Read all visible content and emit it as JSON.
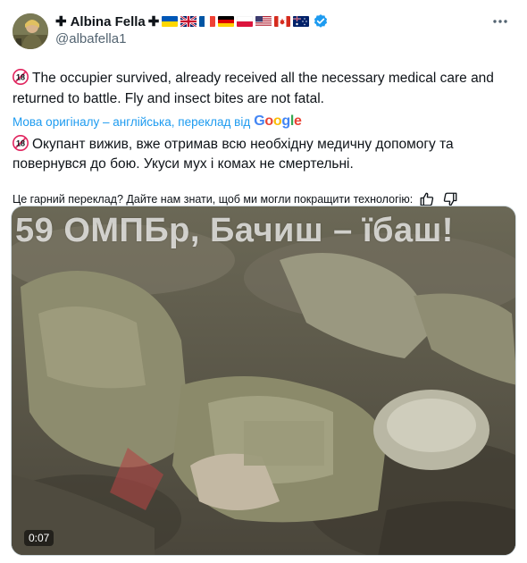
{
  "author": {
    "display_name": "Albina Fella",
    "prefix_symbol": "✚",
    "suffix_symbol": "✚",
    "handle": "@albafella1",
    "verified": true,
    "flags": [
      "ukraine-flag",
      "uk-flag",
      "france-flag",
      "germany-flag",
      "poland-flag",
      "usa-flag",
      "canada-flag",
      "australia-flag"
    ],
    "avatar_icon": "avatar-icon"
  },
  "tweet": {
    "age_badge": "18",
    "original_text": "The occupier survived, already received all the necessary medical care and returned to battle. Fly and insect bites are not fatal.",
    "translation_label": "Мова оригіналу – англійська, переклад від",
    "translation_provider": "Google",
    "translated_text": "Окупант вижив, вже отримав всю необхідну медичну допомогу та повернувся до бою. Укуси мух і комах не смертельні.",
    "feedback_prompt": "Це гарний переклад? Дайте нам знати, щоб ми могли покращити технологію:"
  },
  "media": {
    "caption": "59 ОМПБр, Бачиш – їбаш!",
    "duration": "0:07"
  },
  "colors": {
    "link": "#1d9bf0",
    "text": "#0f1419",
    "secondary": "#536471",
    "verified": "#1d9bf0",
    "badge18": "#e0245e"
  },
  "icons": {
    "more": "more-dots-icon",
    "verified": "verified-check-icon",
    "thumbs_up": "thumbs-up-icon",
    "thumbs_down": "thumbs-down-icon",
    "age_badge": "age-18-icon"
  }
}
